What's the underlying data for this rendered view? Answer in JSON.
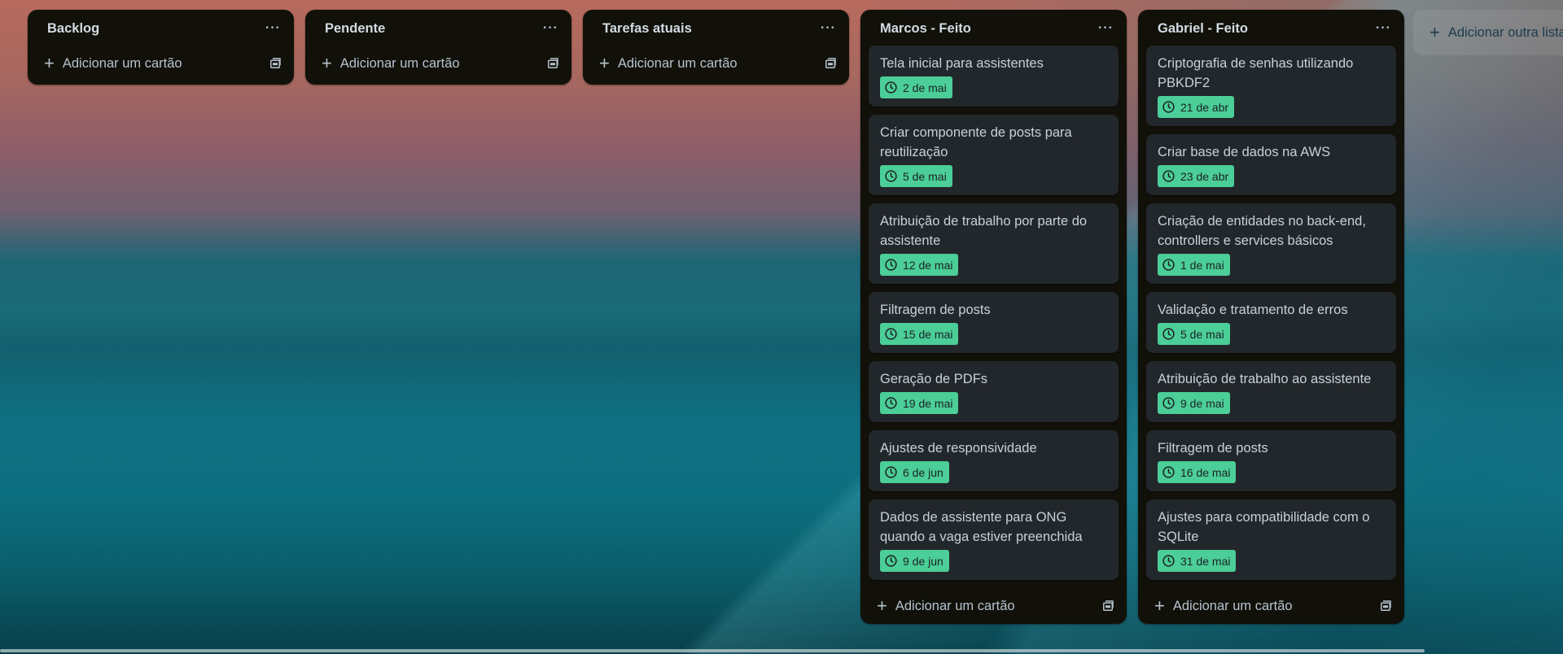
{
  "lists": [
    {
      "title": "Backlog",
      "add_card_label": "Adicionar um cartão",
      "cards": []
    },
    {
      "title": "Pendente",
      "add_card_label": "Adicionar um cartão",
      "cards": []
    },
    {
      "title": "Tarefas atuais",
      "add_card_label": "Adicionar um cartão",
      "cards": []
    },
    {
      "title": "Marcos - Feito",
      "add_card_label": "Adicionar um cartão",
      "cards": [
        {
          "title": "Tela inicial para assistentes",
          "due": "2 de mai"
        },
        {
          "title": "Criar componente de posts para reutilização",
          "due": "5 de mai"
        },
        {
          "title": "Atribuição de trabalho por parte do assistente",
          "due": "12 de mai"
        },
        {
          "title": "Filtragem de posts",
          "due": "15 de mai"
        },
        {
          "title": "Geração de PDFs",
          "due": "19 de mai"
        },
        {
          "title": "Ajustes de responsividade",
          "due": "6 de jun"
        },
        {
          "title": "Dados de assistente para ONG quando a vaga estiver preenchida",
          "due": "9 de jun"
        }
      ]
    },
    {
      "title": "Gabriel - Feito",
      "add_card_label": "Adicionar um cartão",
      "cards": [
        {
          "title": "Criptografia de senhas utilizando PBKDF2",
          "due": "21 de abr"
        },
        {
          "title": "Criar base de dados na AWS",
          "due": "23 de abr"
        },
        {
          "title": "Criação de entidades no back-end, controllers e services básicos",
          "due": "1 de mai"
        },
        {
          "title": "Validação e tratamento de erros",
          "due": "5 de mai"
        },
        {
          "title": "Atribuição de trabalho ao assistente",
          "due": "9 de mai"
        },
        {
          "title": "Filtragem de posts",
          "due": "16 de mai"
        },
        {
          "title": "Ajustes para compatibilidade com o SQLite",
          "due": "31 de mai"
        }
      ]
    }
  ],
  "add_list_label": "Adicionar outra lista",
  "icons": {
    "more": "more-icon",
    "clock": "clock-icon",
    "plus": "plus-icon",
    "template": "card-template-icon"
  },
  "colors": {
    "list_bg": "#111109",
    "card_bg": "#22272b",
    "due_badge": "#4bce97"
  }
}
